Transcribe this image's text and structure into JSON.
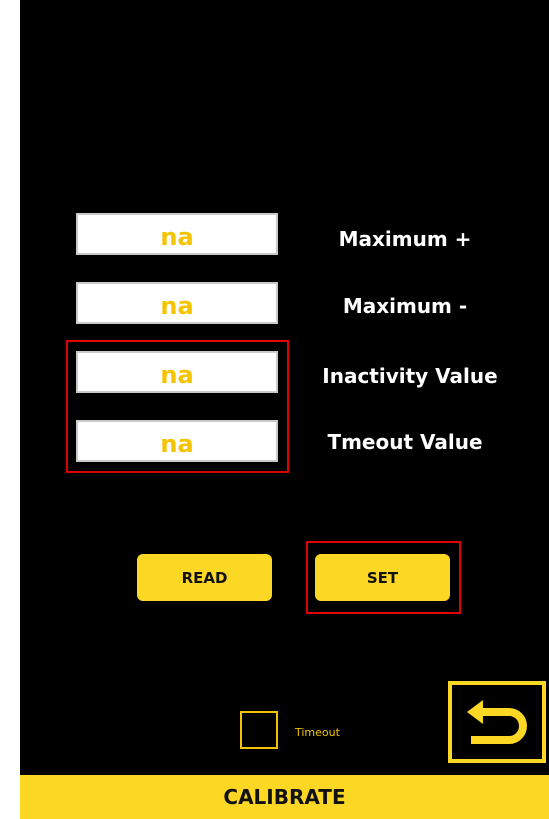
{
  "fields": [
    {
      "value": "na",
      "label": "Maximum +"
    },
    {
      "value": "na",
      "label": "Maximum -"
    },
    {
      "value": "na",
      "label": "Inactivity Value"
    },
    {
      "value": "na",
      "label": "Tmeout Value"
    }
  ],
  "buttons": {
    "read_label": "READ",
    "set_label": "SET"
  },
  "checkbox": {
    "label": "Timeout",
    "checked": false
  },
  "footer": {
    "label": "CALIBRATE"
  },
  "icons": {
    "back": "return-arrow-icon"
  },
  "colors": {
    "accent": "#fcd824",
    "highlight": "#e00000",
    "background": "#000000"
  }
}
